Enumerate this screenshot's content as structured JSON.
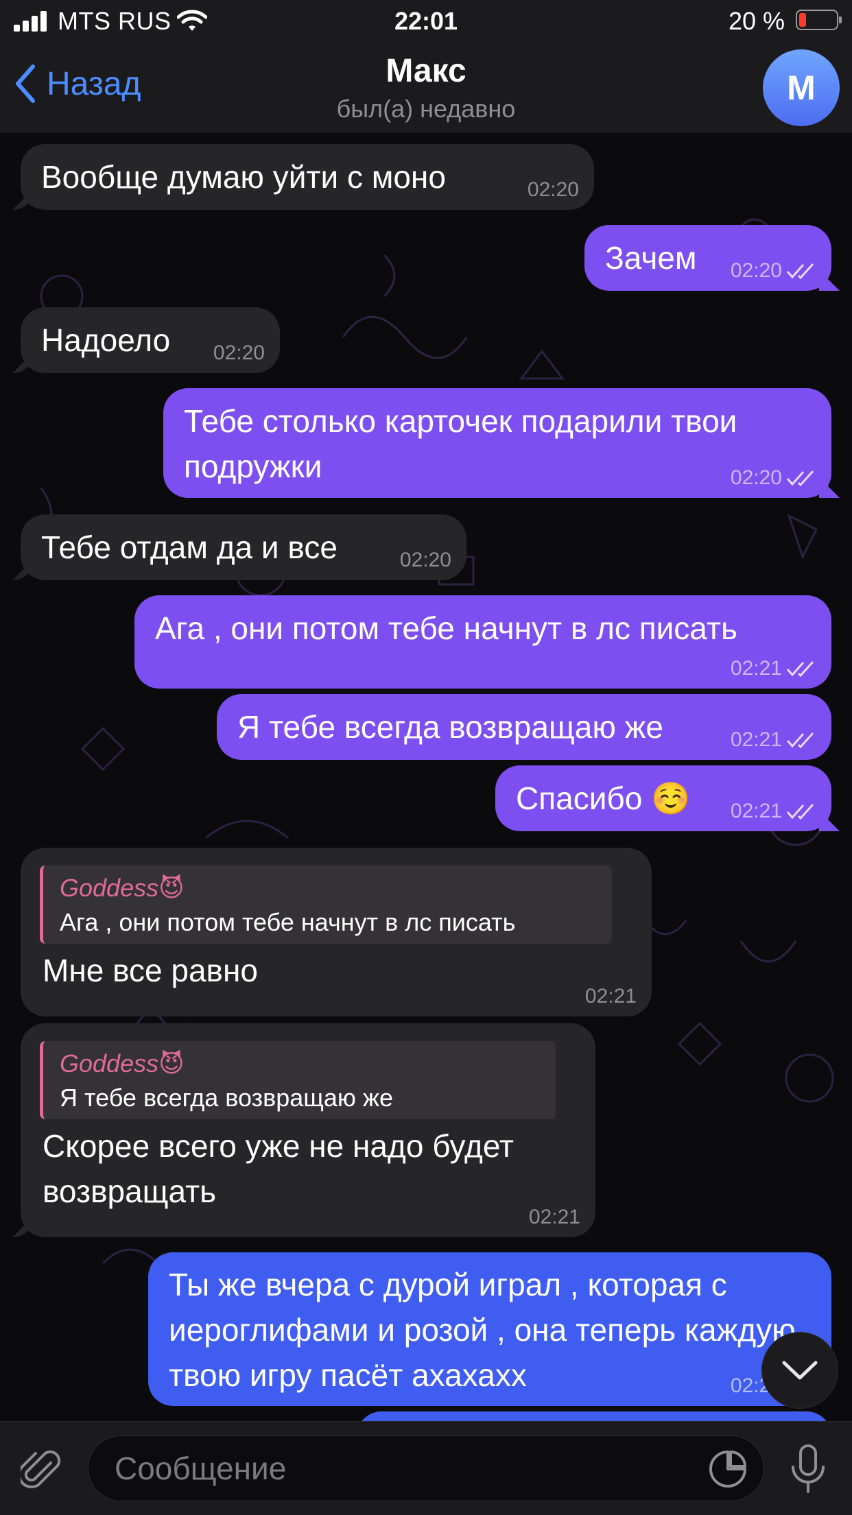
{
  "status_bar": {
    "carrier": "MTS RUS",
    "time": "22:01",
    "battery": "20 %",
    "battery_level": 0.2
  },
  "header": {
    "back_label": "Назад",
    "title": "Макс",
    "status": "был(а) недавно",
    "avatar_letter": "M"
  },
  "messages": [
    {
      "dir": "in",
      "text": "Вообще думаю уйти с моно",
      "time": "02:20"
    },
    {
      "dir": "out",
      "text": "Зачем",
      "time": "02:20",
      "read": true
    },
    {
      "dir": "in",
      "text": "Надоело",
      "time": "02:20"
    },
    {
      "dir": "out",
      "text": "Тебе столько карточек подарили твои подружки",
      "time": "02:20",
      "read": true
    },
    {
      "dir": "in",
      "text": "Тебе отдам да и все",
      "time": "02:20"
    },
    {
      "dir": "out",
      "text": "Ага , они потом тебе начнут в лс писать",
      "time": "02:21",
      "read": true
    },
    {
      "dir": "out",
      "text": "Я тебе всегда возвращаю же",
      "time": "02:21",
      "read": true
    },
    {
      "dir": "out",
      "text": "Спасибо ☺️",
      "time": "02:21",
      "read": true
    },
    {
      "dir": "in",
      "reply_name": "Goddess😈",
      "reply_text": "Ага , они потом тебе начнут в лс писать",
      "text": "Мне все равно",
      "time": "02:21"
    },
    {
      "dir": "in",
      "reply_name": "Goddess😈",
      "reply_text": "Я тебе всегда возвращаю же",
      "text": "Скорее всего уже не надо будет возвращать",
      "time": "02:21"
    },
    {
      "dir": "out",
      "text": "Ты же вчера с дурой играл , которая с иероглифами и розой , она теперь каждую твою игру пасёт ахахахх",
      "time": "02:21",
      "read": true
    }
  ],
  "input": {
    "placeholder": "Сообщение"
  },
  "colors": {
    "incoming": "#262628",
    "outgoing": "#7e4ff0",
    "outgoing_latest": "#3f5df0",
    "accent": "#4c8dff",
    "reply_accent": "#e06b94"
  },
  "icons": [
    "signal-icon",
    "wifi-icon",
    "battery-icon",
    "chevron-left-icon",
    "paperclip-icon",
    "sticker-icon",
    "microphone-icon",
    "chevron-down-icon",
    "double-check-icon"
  ]
}
